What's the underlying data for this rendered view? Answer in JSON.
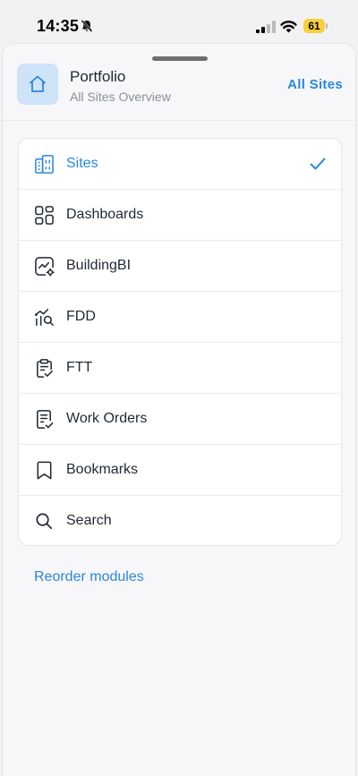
{
  "status_bar": {
    "time": "14:35",
    "battery": "61"
  },
  "header": {
    "title": "Portfolio",
    "subtitle": "All Sites Overview",
    "action": "All Sites"
  },
  "modules": [
    {
      "label": "Sites",
      "icon": "building-icon",
      "active": true
    },
    {
      "label": "Dashboards",
      "icon": "dashboard-grid-icon"
    },
    {
      "label": "BuildingBI",
      "icon": "chart-gear-icon"
    },
    {
      "label": "FDD",
      "icon": "fault-detection-icon"
    },
    {
      "label": "FTT",
      "icon": "clipboard-check-icon"
    },
    {
      "label": "Work Orders",
      "icon": "work-order-icon"
    },
    {
      "label": "Bookmarks",
      "icon": "bookmark-icon"
    },
    {
      "label": "Search",
      "icon": "search-icon"
    }
  ],
  "reorder_label": "Reorder modules",
  "colors": {
    "accent": "#2a86de",
    "tile": "#cfe3f8",
    "battery": "#f6d23a"
  }
}
